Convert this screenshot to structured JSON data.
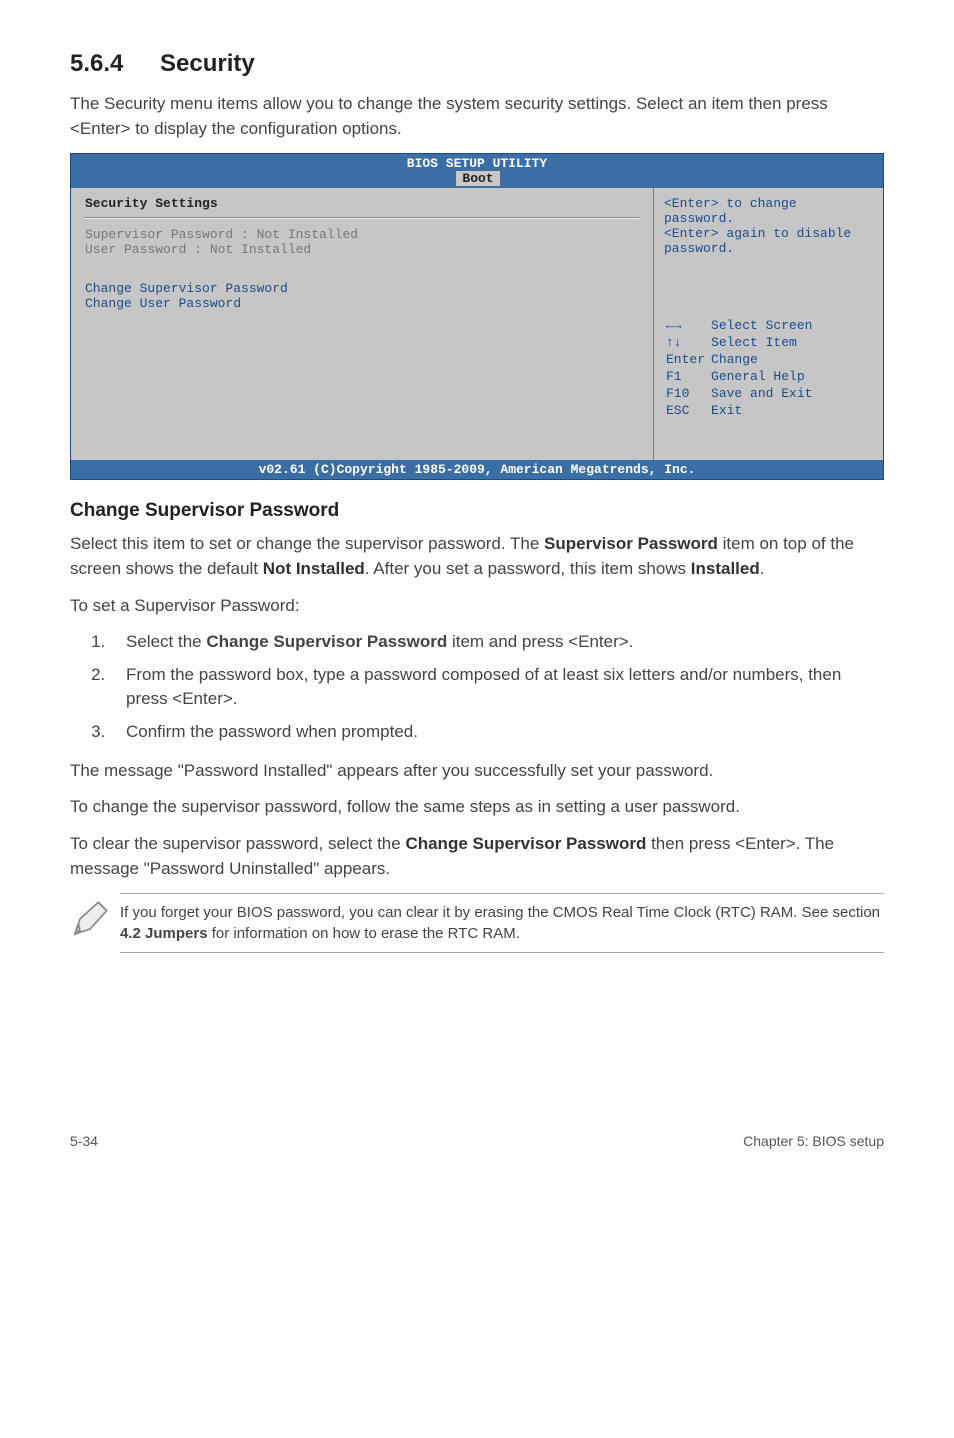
{
  "heading": {
    "number": "5.6.4",
    "title": "Security"
  },
  "intro": "The Security menu items allow you to change the system security settings. Select an item then press <Enter> to display the configuration options.",
  "bios": {
    "title": "BIOS SETUP UTILITY",
    "tab": "Boot",
    "main": {
      "header": "Security Settings",
      "line1": "Supervisor Password : Not Installed",
      "line2": "User Password       : Not Installed",
      "action1": "Change Supervisor Password",
      "action2": "Change User Password"
    },
    "side": {
      "help1": "<Enter> to change password.",
      "help2": "<Enter> again to disable password.",
      "nav": {
        "r1a": "←→",
        "r1b": "Select Screen",
        "r2a": "↑↓",
        "r2b": "Select Item",
        "r3a": "Enter",
        "r3b": "Change",
        "r4a": "F1",
        "r4b": "General Help",
        "r5a": "F10",
        "r5b": "Save and Exit",
        "r6a": "ESC",
        "r6b": "Exit"
      }
    },
    "footer": "v02.61 (C)Copyright 1985-2009, American Megatrends, Inc."
  },
  "subhead": "Change Supervisor Password",
  "p1a": "Select this item to set or change the supervisor password. The ",
  "p1b": "Supervisor Password",
  "p1c": " item on top of the screen shows the default ",
  "p1d": "Not Installed",
  "p1e": ". After you set a password, this item shows ",
  "p1f": "Installed",
  "p1g": ".",
  "p2": "To set a Supervisor Password:",
  "steps": {
    "s1a": "Select the ",
    "s1b": "Change Supervisor Password",
    "s1c": " item and press <Enter>.",
    "s2": "From the password box, type a password composed of at least six letters and/or numbers, then press <Enter>.",
    "s3": "Confirm the password when prompted."
  },
  "p3": "The message \"Password Installed\" appears after you successfully set your password.",
  "p4": "To change the supervisor password, follow the same steps as in setting a user password.",
  "p5a": "To clear the supervisor password, select the ",
  "p5b": "Change Supervisor Password",
  "p5c": " then press <Enter>. The message \"Password Uninstalled\" appears.",
  "note_a": "If you forget your BIOS password, you can clear it by erasing the CMOS Real Time Clock (RTC) RAM. See section ",
  "note_b": "4.2 Jumpers",
  "note_c": " for information on how to erase the RTC RAM.",
  "footer": {
    "left": "5-34",
    "right": "Chapter 5: BIOS setup"
  }
}
